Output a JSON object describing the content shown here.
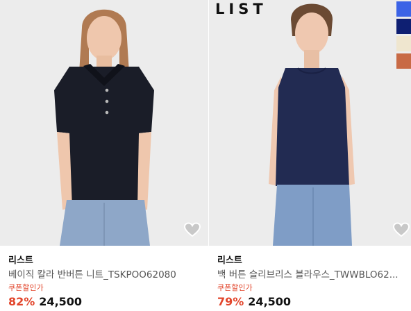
{
  "products": [
    {
      "brand": "리스트",
      "title": "베이직 칼라 반버튼 니트_TSKPOO62080",
      "coupon": "쿠폰할인가",
      "discount": "82%",
      "price": "24,500",
      "wishlist_icon": "heart-outline-icon"
    },
    {
      "brand": "리스트",
      "title": "백 버튼 슬리브리스 블라우스_TWWBLO62...",
      "coupon": "쿠폰할인가",
      "discount": "79%",
      "price": "24,500",
      "wishlist_icon": "heart-outline-icon",
      "logo_text": "LIST",
      "swatches": [
        "#3b63e6",
        "#0e1f72",
        "#efe6cf",
        "#c86a45"
      ]
    }
  ],
  "colors": {
    "accent_red": "#e2452b",
    "photo_bg": "#ececec"
  }
}
